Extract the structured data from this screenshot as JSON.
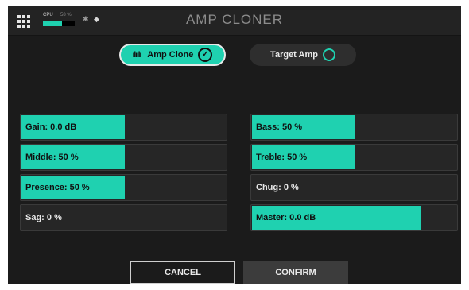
{
  "topbar": {
    "title": "AMP CLONER",
    "cpu_label": "CPU",
    "cpu_percent_text": "58 %",
    "cpu_level": 0.6
  },
  "modes": {
    "clone_label": "Amp Clone",
    "target_label": "Target Amp",
    "selected": "clone"
  },
  "params": [
    {
      "label": "Gain: 0.0 dB",
      "level": 0.5
    },
    {
      "label": "Bass: 50 %",
      "level": 0.5
    },
    {
      "label": "Middle: 50 %",
      "level": 0.5
    },
    {
      "label": "Treble: 50 %",
      "level": 0.5
    },
    {
      "label": "Presence: 50 %",
      "level": 0.5
    },
    {
      "label": "Chug: 0 %",
      "level": 0
    },
    {
      "label": "Sag: 0 %",
      "level": 0
    },
    {
      "label": "Master: 0.0 dB",
      "level": 0.82
    }
  ],
  "actions": {
    "cancel": "CANCEL",
    "confirm": "CONFIRM"
  },
  "colors": {
    "accent": "#1fd1b0",
    "background": "#1b1b1b",
    "slider_bg": "#262626"
  },
  "icons": [
    "menu-grid-icon",
    "bluetooth-icon",
    "wifi-icon",
    "waveform-icon",
    "check-circle-icon",
    "empty-circle-icon"
  ]
}
